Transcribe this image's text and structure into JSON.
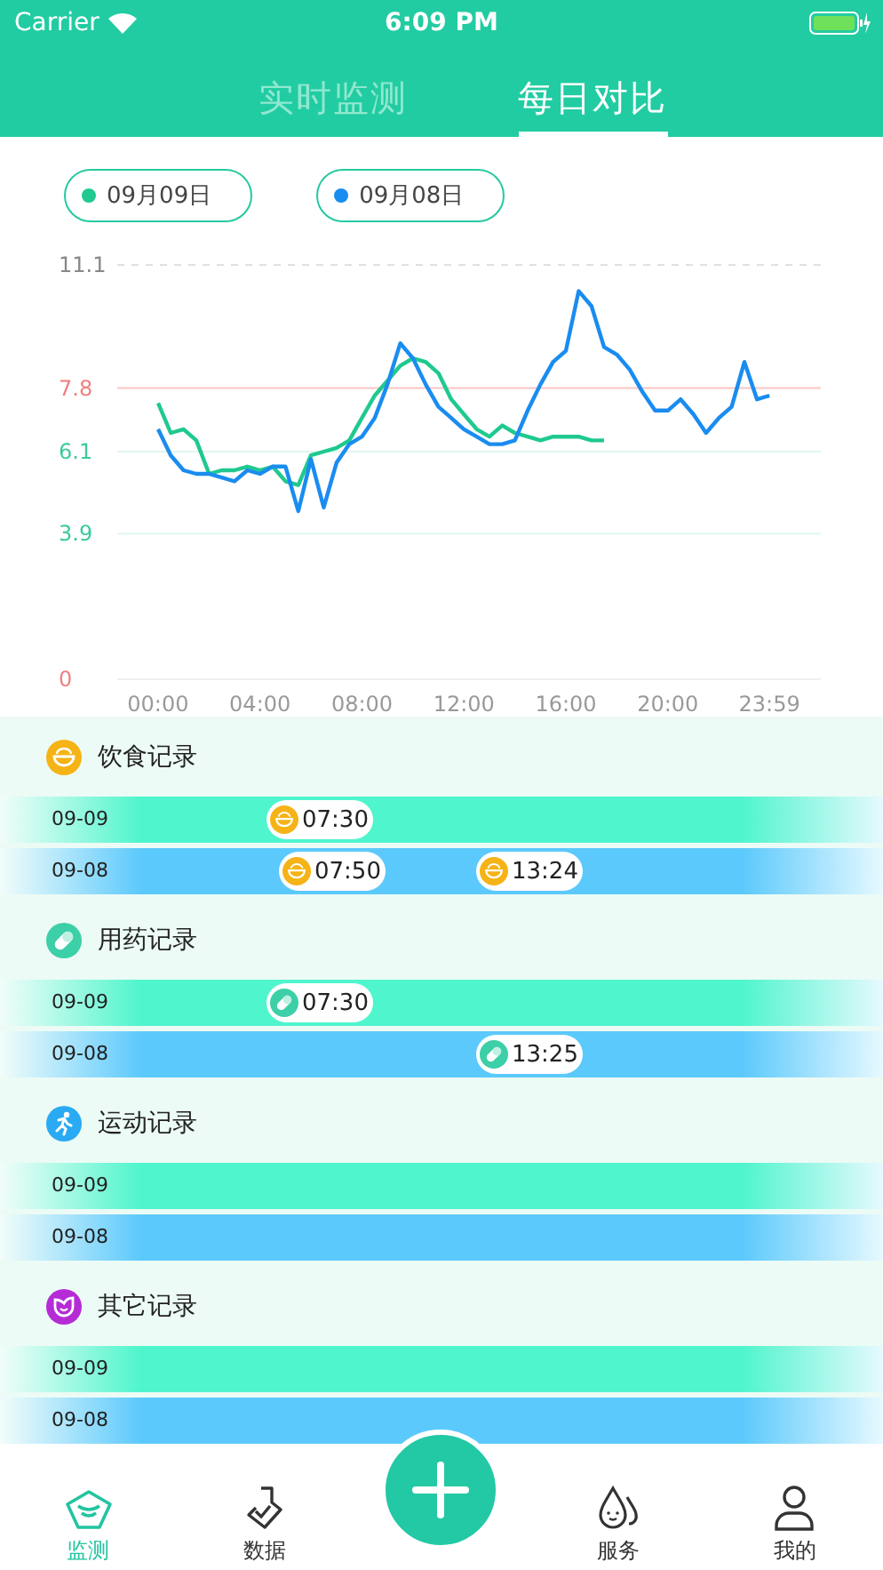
{
  "status_bar": {
    "carrier": "Carrier",
    "time": "6:09 PM"
  },
  "tabs": [
    {
      "label": "实时监测",
      "selected": false
    },
    {
      "label": "每日对比",
      "selected": true
    }
  ],
  "chart_data": {
    "type": "line",
    "x": [
      0,
      30,
      60,
      90,
      120,
      150,
      180,
      210,
      240,
      270,
      300,
      330,
      360,
      390,
      420,
      450,
      480,
      510,
      540,
      570,
      600,
      630,
      660,
      690,
      720,
      750,
      780,
      810,
      840,
      870,
      900,
      930,
      960,
      990,
      1020,
      1050,
      1080,
      1110,
      1140,
      1170,
      1200,
      1230,
      1260,
      1290,
      1320,
      1350,
      1380,
      1410,
      1439
    ],
    "series": [
      {
        "name": "09月09日",
        "color": "#1fc98f",
        "values": [
          7.4,
          6.6,
          6.7,
          6.4,
          5.5,
          5.6,
          5.6,
          5.7,
          5.6,
          5.7,
          5.3,
          5.2,
          6.0,
          6.1,
          6.2,
          6.4,
          7.0,
          7.6,
          8.0,
          8.4,
          8.6,
          8.5,
          8.2,
          7.5,
          7.1,
          6.7,
          6.5,
          6.8,
          6.6,
          6.5,
          6.4,
          6.5,
          6.5,
          6.5,
          6.4,
          6.4,
          null,
          null,
          null,
          null,
          null,
          null,
          null,
          null,
          null,
          null,
          null,
          null,
          null
        ]
      },
      {
        "name": "09月08日",
        "color": "#1a8cf0",
        "values": [
          6.7,
          6.0,
          5.6,
          5.5,
          5.5,
          5.4,
          5.3,
          5.6,
          5.5,
          5.7,
          5.7,
          4.5,
          5.9,
          4.6,
          5.8,
          6.3,
          6.5,
          7.0,
          7.9,
          9.0,
          8.6,
          7.9,
          7.3,
          7.0,
          6.7,
          6.5,
          6.3,
          6.3,
          6.4,
          7.2,
          7.9,
          8.5,
          8.8,
          10.4,
          10.0,
          8.9,
          8.7,
          8.3,
          7.7,
          7.2,
          7.2,
          7.5,
          7.1,
          6.6,
          7.0,
          7.3,
          8.5,
          7.5,
          7.6
        ]
      }
    ],
    "xlim": [
      -96,
      1560
    ],
    "ylim": [
      0,
      11.1
    ],
    "xticks": [
      {
        "value": 0,
        "label": "00:00"
      },
      {
        "value": 240,
        "label": "04:00"
      },
      {
        "value": 480,
        "label": "08:00"
      },
      {
        "value": 720,
        "label": "12:00"
      },
      {
        "value": 960,
        "label": "16:00"
      },
      {
        "value": 1200,
        "label": "20:00"
      },
      {
        "value": 1439,
        "label": "23:59"
      }
    ],
    "yticks": [
      0,
      3.9,
      6.1,
      11.1
    ],
    "ref_lines": [
      {
        "axis": "y",
        "value": 7.8,
        "label": "7.8",
        "color": "#f9c6c6"
      }
    ]
  },
  "records": [
    {
      "kind": "food",
      "title": "饮食记录",
      "rows": [
        {
          "date": "09-09",
          "color": "#4ff5cc",
          "events": [
            {
              "time": "07:30"
            }
          ]
        },
        {
          "date": "09-08",
          "color": "#5cc9fc",
          "events": [
            {
              "time": "07:50"
            },
            {
              "time": "13:24"
            }
          ]
        }
      ]
    },
    {
      "kind": "medicine",
      "title": "用药记录",
      "rows": [
        {
          "date": "09-09",
          "color": "#4ff5cc",
          "events": [
            {
              "time": "07:30"
            }
          ]
        },
        {
          "date": "09-08",
          "color": "#5cc9fc",
          "events": [
            {
              "time": "13:25"
            }
          ]
        }
      ]
    },
    {
      "kind": "sport",
      "title": "运动记录",
      "rows": [
        {
          "date": "09-09",
          "color": "#4ff5cc"
        },
        {
          "date": "09-08",
          "color": "#5cc9fc"
        }
      ]
    },
    {
      "kind": "other",
      "title": "其它记录",
      "rows": [
        {
          "date": "09-09",
          "color": "#4ff5cc"
        },
        {
          "date": "09-08",
          "color": "#5cc9fc"
        }
      ]
    }
  ],
  "bottom_nav": [
    {
      "kind": "monitor",
      "label": "监测",
      "selected": true
    },
    {
      "kind": "data",
      "label": "数据",
      "selected": false
    },
    {
      "kind": "add"
    },
    {
      "kind": "service",
      "label": "服务",
      "selected": false
    },
    {
      "kind": "profile",
      "label": "我的",
      "selected": false
    }
  ]
}
